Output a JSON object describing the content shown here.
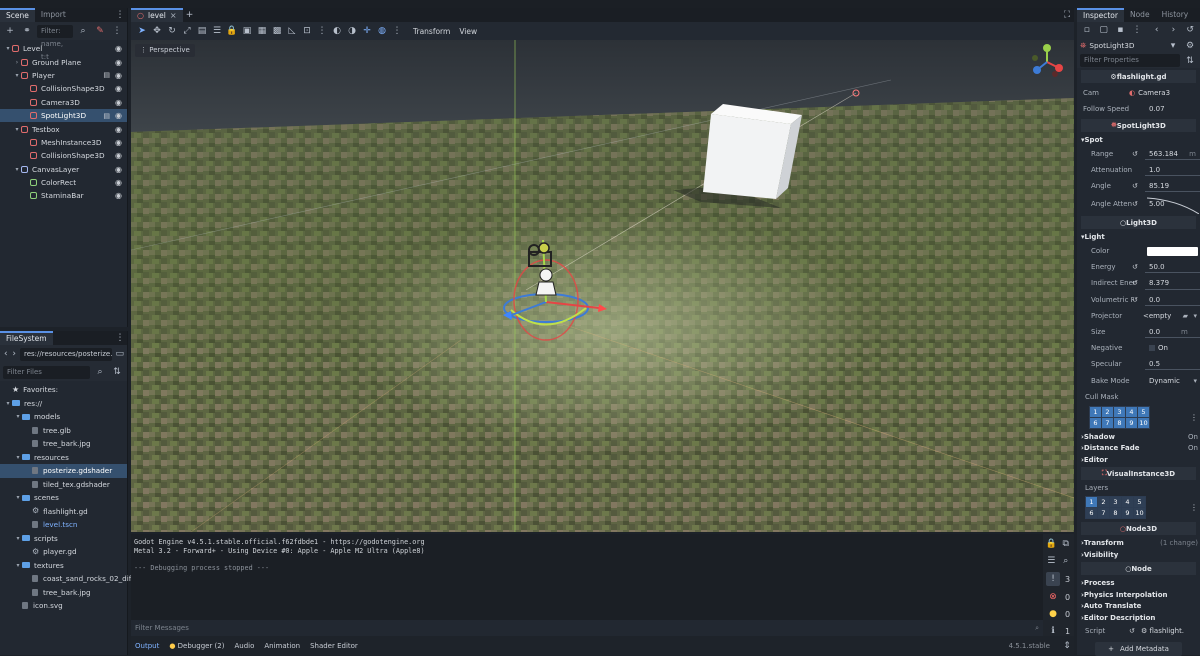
{
  "scene_dock": {
    "tabs": [
      "Scene",
      "Import"
    ],
    "filter_placeholder": "Filter: name, t:t",
    "tree": [
      {
        "label": "Level",
        "indent": 0,
        "color": "#e06c6c",
        "caret": "v",
        "eye": true
      },
      {
        "label": "Ground Plane",
        "indent": 1,
        "color": "#e06c6c",
        "caret": ">",
        "eye": true
      },
      {
        "label": "Player",
        "indent": 1,
        "color": "#e06c6c",
        "caret": "v",
        "eye": true,
        "script": true
      },
      {
        "label": "CollisionShape3D",
        "indent": 2,
        "color": "#e06c6c",
        "eye": true
      },
      {
        "label": "Camera3D",
        "indent": 2,
        "color": "#e06c6c",
        "eye": true
      },
      {
        "label": "SpotLight3D",
        "indent": 2,
        "color": "#e06c6c",
        "eye": true,
        "script": true,
        "selected": true
      },
      {
        "label": "Testbox",
        "indent": 1,
        "color": "#e06c6c",
        "caret": "v",
        "eye": true
      },
      {
        "label": "MeshInstance3D",
        "indent": 2,
        "color": "#e06c6c",
        "eye": true
      },
      {
        "label": "CollisionShape3D",
        "indent": 2,
        "color": "#e06c6c",
        "eye": true
      },
      {
        "label": "CanvasLayer",
        "indent": 1,
        "color": "#a5b7f0",
        "caret": "v",
        "eye": true
      },
      {
        "label": "ColorRect",
        "indent": 2,
        "color": "#8ed07a",
        "eye": true
      },
      {
        "label": "StaminaBar",
        "indent": 2,
        "color": "#8ed07a",
        "eye": true
      }
    ]
  },
  "filesystem": {
    "tab": "FileSystem",
    "path": "res://resources/posterize.",
    "filter_placeholder": "Filter Files",
    "items": [
      {
        "label": "Favorites:",
        "indent": 0,
        "kind": "star"
      },
      {
        "label": "res://",
        "indent": 0,
        "kind": "folder",
        "caret": "v"
      },
      {
        "label": "models",
        "indent": 1,
        "kind": "folder",
        "caret": "v"
      },
      {
        "label": "tree.glb",
        "indent": 2,
        "kind": "file"
      },
      {
        "label": "tree_bark.jpg",
        "indent": 2,
        "kind": "file"
      },
      {
        "label": "resources",
        "indent": 1,
        "kind": "folder",
        "caret": "v"
      },
      {
        "label": "posterize.gdshader",
        "indent": 2,
        "kind": "file",
        "selected": true
      },
      {
        "label": "tiled_tex.gdshader",
        "indent": 2,
        "kind": "file"
      },
      {
        "label": "scenes",
        "indent": 1,
        "kind": "folder",
        "caret": "v"
      },
      {
        "label": "flashlight.gd",
        "indent": 2,
        "kind": "gear"
      },
      {
        "label": "level.tscn",
        "indent": 2,
        "kind": "file",
        "link": true
      },
      {
        "label": "scripts",
        "indent": 1,
        "kind": "folder",
        "caret": "v"
      },
      {
        "label": "player.gd",
        "indent": 2,
        "kind": "gear"
      },
      {
        "label": "textures",
        "indent": 1,
        "kind": "folder",
        "caret": "v"
      },
      {
        "label": "coast_sand_rocks_02_diff_...",
        "indent": 2,
        "kind": "file"
      },
      {
        "label": "tree_bark.jpg",
        "indent": 2,
        "kind": "file"
      },
      {
        "label": "icon.svg",
        "indent": 1,
        "kind": "file"
      }
    ]
  },
  "editor": {
    "tab": "level",
    "menu_transform": "Transform",
    "menu_view": "View",
    "viewport_label": "Perspective"
  },
  "console": {
    "lines": [
      "Godot Engine v4.5.1.stable.official.f62fdbde1 - https://godotengine.org",
      "Metal 3.2 - Forward+ - Using Device #0: Apple - Apple M2 Ultra (Apple8)",
      "",
      "--- Debugging process stopped ---"
    ],
    "filter_placeholder": "Filter Messages",
    "counts": {
      "messages": "3",
      "errors": "0",
      "warnings": "0",
      "info": "1"
    }
  },
  "bottom_tabs": {
    "output": "Output",
    "debugger": "Debugger (2)",
    "audio": "Audio",
    "animation": "Animation",
    "shader_editor": "Shader Editor",
    "version": "4.5.1.stable"
  },
  "inspector": {
    "tabs": [
      "Inspector",
      "Node",
      "History"
    ],
    "node_name": "SpotLight3D",
    "filter_placeholder": "Filter Properties",
    "script_header": "flashlight.gd",
    "cam_label": "Cam",
    "cam_value": "Camera3",
    "follow_label": "Follow Speed",
    "follow_value": "0.07",
    "spotlight_header": "SpotLight3D",
    "spot_section": "Spot",
    "range_label": "Range",
    "range_value": "563.184",
    "range_unit": "m",
    "atten_label": "Attenuation",
    "atten_value": "1.0",
    "angle_label": "Angle",
    "angle_value": "85.19",
    "angle_atten_label": "Angle Atten",
    "angle_atten_value": "5.00",
    "light3d_header": "Light3D",
    "light_section": "Light",
    "color_label": "Color",
    "energy_label": "Energy",
    "energy_value": "50.0",
    "indirect_label": "Indirect Ener",
    "indirect_value": "8.379",
    "volumetric_label": "Volumetric F",
    "volumetric_value": "0.0",
    "projector_label": "Projector",
    "projector_value": "<empty",
    "size_label": "Size",
    "size_value": "0.0",
    "size_unit": "m",
    "negative_label": "Negative",
    "negative_value": "On",
    "specular_label": "Specular",
    "specular_value": "0.5",
    "bake_label": "Bake Mode",
    "bake_value": "Dynamic",
    "cullmask_label": "Cull Mask",
    "cull_layers": [
      "1",
      "2",
      "3",
      "4",
      "5",
      "6",
      "7",
      "8",
      "9",
      "10"
    ],
    "shadow_label": "Shadow",
    "shadow_value": "On",
    "distfade_label": "Distance Fade",
    "distfade_value": "On",
    "editor_section": "Editor",
    "visual_header": "VisualInstance3D",
    "layers_label": "Layers",
    "vis_layers": [
      "1",
      "2",
      "3",
      "4",
      "5",
      "6",
      "7",
      "8",
      "9",
      "10"
    ],
    "node3d_header": "Node3D",
    "transform_section": "Transform",
    "transform_changes": "(1 change)",
    "visibility_section": "Visibility",
    "node_header": "Node",
    "process_section": "Process",
    "physics_section": "Physics Interpolation",
    "autotranslate_section": "Auto Translate",
    "editordesc_section": "Editor Description",
    "script_label": "Script",
    "script_value": "flashlight.",
    "add_metadata": "Add Metadata"
  },
  "colors": {
    "accent": "#5a91e6",
    "selection": "#35506e",
    "panel": "#222831",
    "node3d_red": "#e06c6c",
    "control_green": "#8ed07a"
  }
}
